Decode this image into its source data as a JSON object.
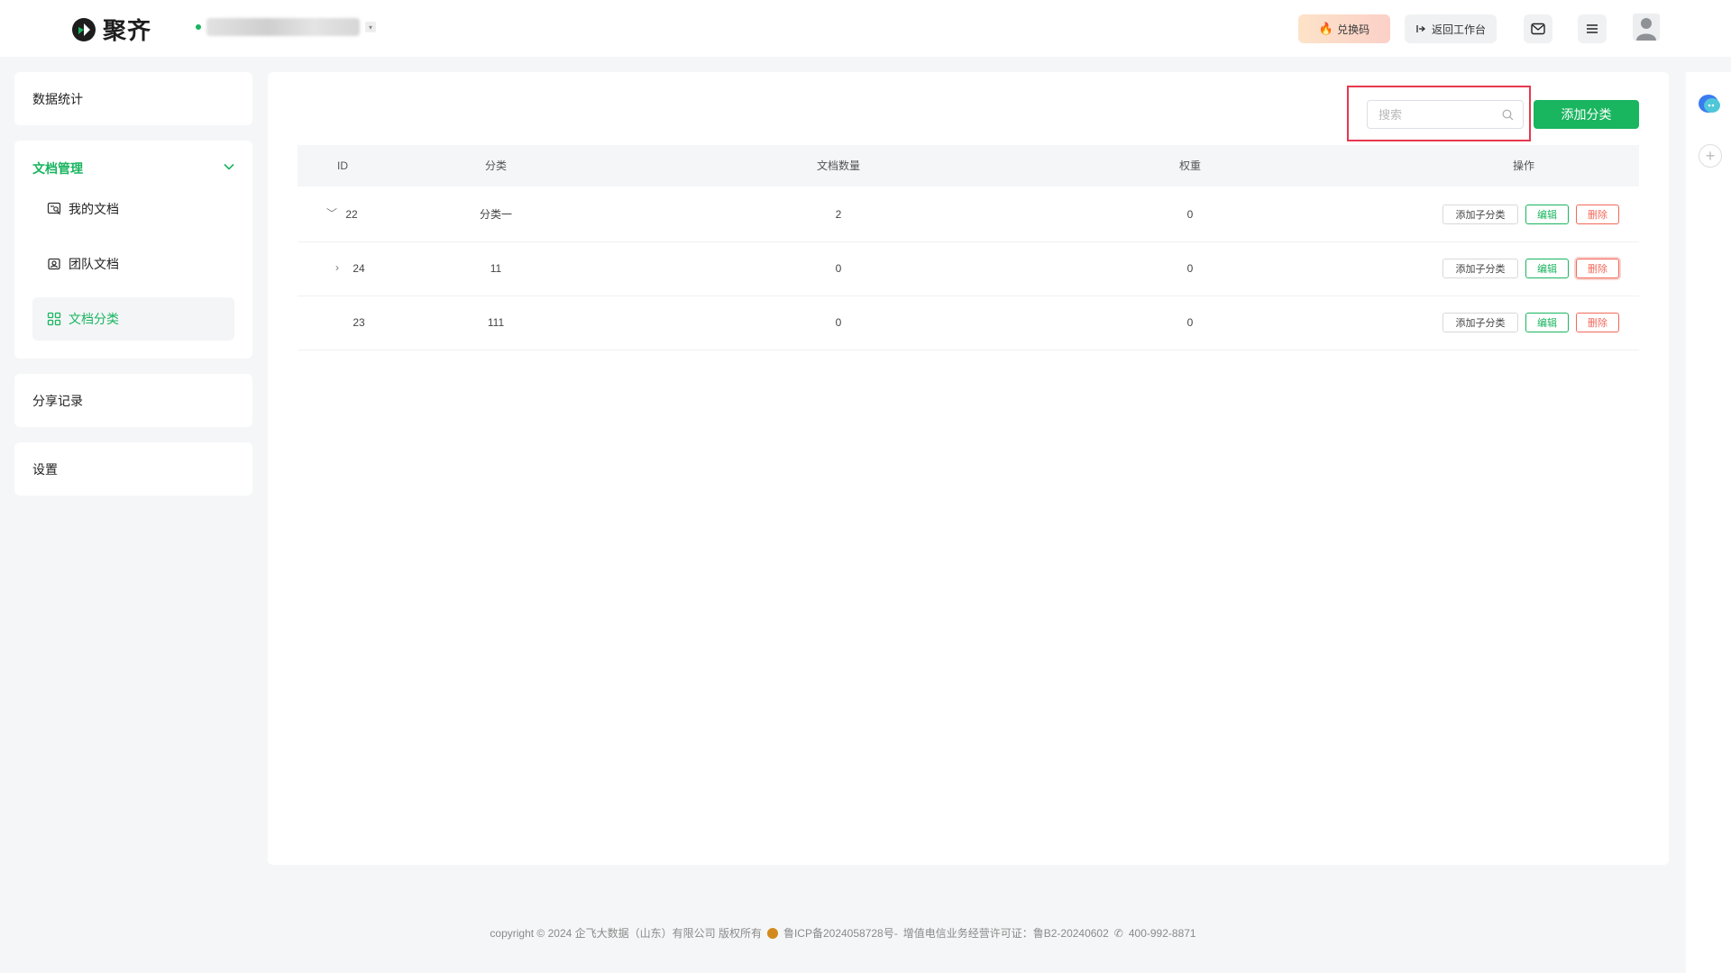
{
  "header": {
    "logo_text": "聚齐",
    "workspace_name": "",
    "redeem_label": "兑换码",
    "back_label": "返回工作台"
  },
  "sidebar": {
    "stats": "数据统计",
    "doc_manage": {
      "title": "文档管理",
      "items": [
        {
          "label": "我的文档"
        },
        {
          "label": "团队文档"
        },
        {
          "label": "文档分类"
        }
      ]
    },
    "share": "分享记录",
    "settings": "设置"
  },
  "toolbar": {
    "search_placeholder": "搜索",
    "add_label": "添加分类"
  },
  "table": {
    "headers": {
      "id": "ID",
      "category": "分类",
      "count": "文档数量",
      "weight": "权重",
      "actions": "操作"
    },
    "rows": [
      {
        "id": "22",
        "category": "分类一",
        "count": "2",
        "weight": "0",
        "expander": "﹀"
      },
      {
        "id": "24",
        "category": "11",
        "count": "0",
        "weight": "0",
        "expander": "›"
      },
      {
        "id": "23",
        "category": "111",
        "count": "0",
        "weight": "0",
        "expander": ""
      }
    ],
    "actions": {
      "add_sub": "添加子分类",
      "edit": "编辑",
      "delete": "删除"
    }
  },
  "footer": {
    "copyright": "copyright © 2024 企飞大数据（山东）有限公司 版权所有",
    "icp": "鲁ICP备2024058728号-",
    "license": "增值电信业务经营许可证：鲁B2-20240602",
    "phone": "400-992-8871"
  },
  "colors": {
    "accent": "#19b55f",
    "danger": "#f2695a",
    "highlight": "#e8384f"
  }
}
